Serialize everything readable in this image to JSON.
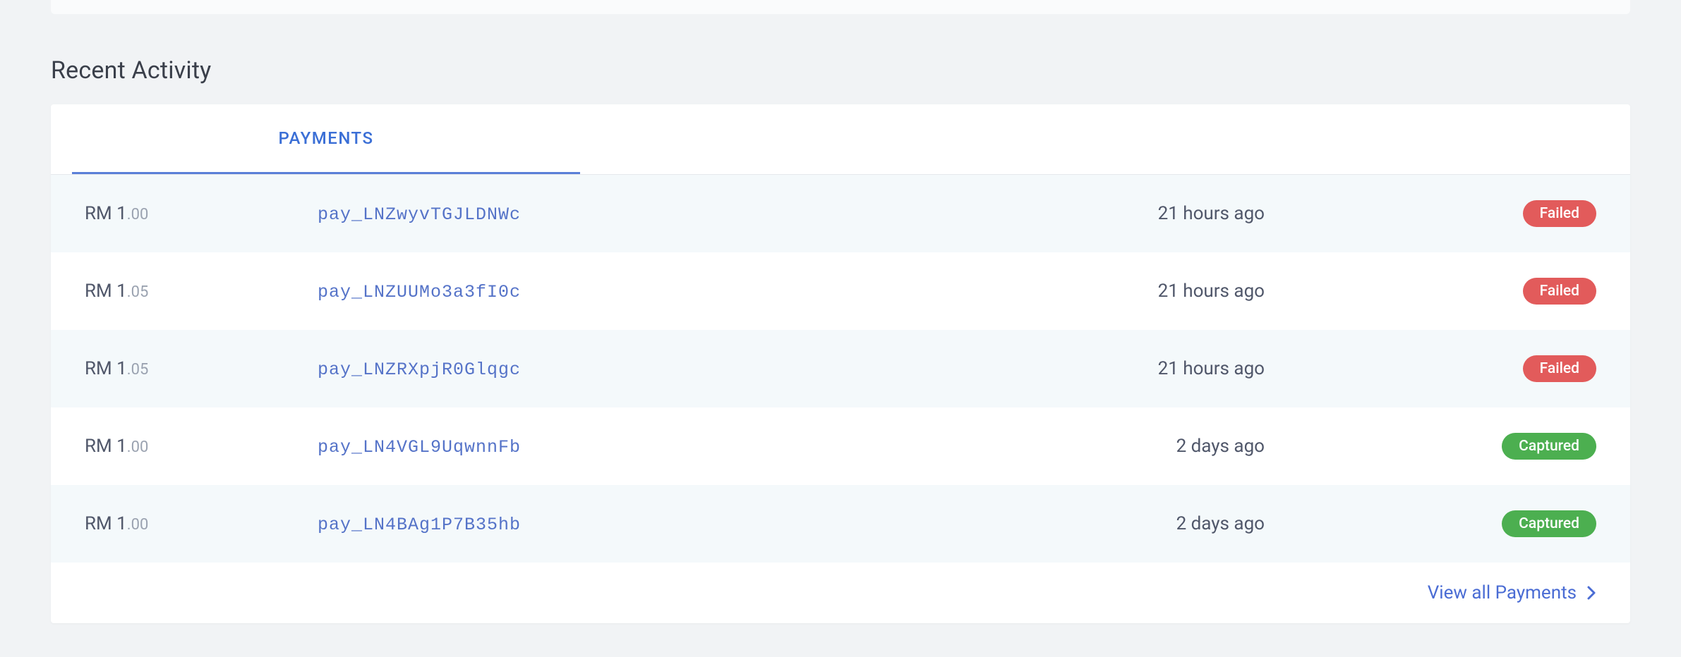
{
  "section_title": "Recent Activity",
  "tab": {
    "label": "PAYMENTS"
  },
  "colors": {
    "link": "#5573c8",
    "failed": "#e25b5b",
    "captured": "#4caf50"
  },
  "rows": [
    {
      "currency": "RM",
      "whole": "1",
      "cents": ".00",
      "pay_id": "pay_LNZwyvTGJLDNWc",
      "time": "21 hours ago",
      "status_label": "Failed",
      "status": "failed"
    },
    {
      "currency": "RM",
      "whole": "1",
      "cents": ".05",
      "pay_id": "pay_LNZUUMo3a3fI0c",
      "time": "21 hours ago",
      "status_label": "Failed",
      "status": "failed"
    },
    {
      "currency": "RM",
      "whole": "1",
      "cents": ".05",
      "pay_id": "pay_LNZRXpjR0Glqgc",
      "time": "21 hours ago",
      "status_label": "Failed",
      "status": "failed"
    },
    {
      "currency": "RM",
      "whole": "1",
      "cents": ".00",
      "pay_id": "pay_LN4VGL9UqwnnFb",
      "time": "2 days ago",
      "status_label": "Captured",
      "status": "captured"
    },
    {
      "currency": "RM",
      "whole": "1",
      "cents": ".00",
      "pay_id": "pay_LN4BAg1P7B35hb",
      "time": "2 days ago",
      "status_label": "Captured",
      "status": "captured"
    }
  ],
  "footer": {
    "label": "View all Payments"
  }
}
